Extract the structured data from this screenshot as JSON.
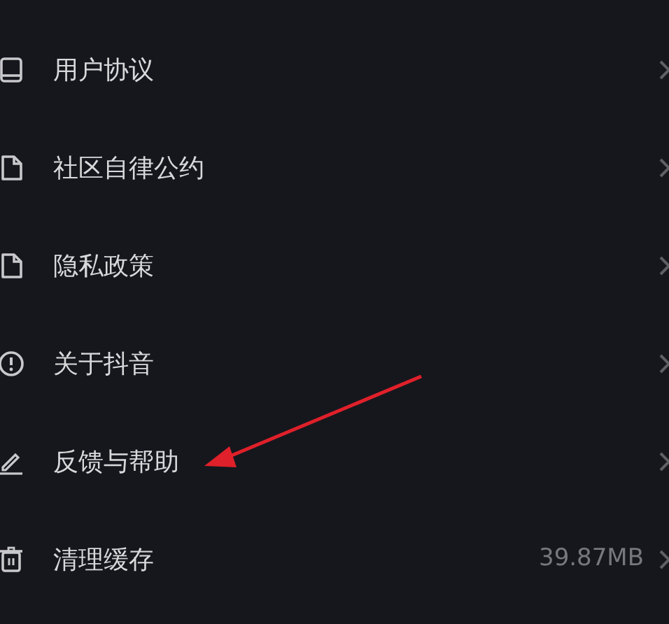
{
  "settings_items": [
    {
      "label": "用户协议",
      "pointed": false
    },
    {
      "label": "社区自律公约",
      "pointed": false
    },
    {
      "label": "隐私政策",
      "pointed": false
    },
    {
      "label": "关于抖音",
      "pointed": false
    },
    {
      "label": "反馈与帮助",
      "pointed": true
    },
    {
      "label": "清理缓存",
      "value": "39.87MB",
      "pointed": false
    }
  ]
}
